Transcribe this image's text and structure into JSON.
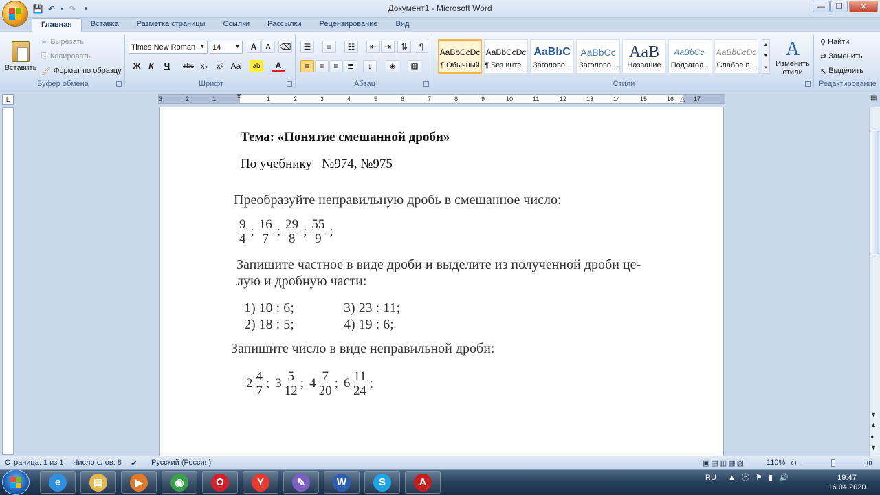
{
  "window": {
    "title": "Документ1 - Microsoft Word",
    "minimize": "—",
    "restore": "❐",
    "close": "✕"
  },
  "qat": {
    "save": "💾",
    "undo": "↶",
    "redo": "↷",
    "more": "▾"
  },
  "tabs": [
    "Главная",
    "Вставка",
    "Разметка страницы",
    "Ссылки",
    "Рассылки",
    "Рецензирование",
    "Вид"
  ],
  "ribbon": {
    "clipboard": {
      "label": "Буфер обмена",
      "paste": "Вставить",
      "cut": "Вырезать",
      "copy": "Копировать",
      "format_painter": "Формат по образцу"
    },
    "font": {
      "label": "Шрифт",
      "font_name": "Times New Roman",
      "font_size": "14",
      "grow": "A",
      "shrink": "A",
      "bold": "Ж",
      "italic": "К",
      "underline": "Ч",
      "strike": "abc",
      "subscript": "x₂",
      "superscript": "x²",
      "case": "Aa",
      "highlight": "ab",
      "font_color": "A"
    },
    "paragraph": {
      "label": "Абзац"
    },
    "styles": {
      "label": "Стили",
      "items": [
        {
          "preview": "AaBbCcDc",
          "name": "¶ Обычный"
        },
        {
          "preview": "AaBbCcDc",
          "name": "¶ Без инте..."
        },
        {
          "preview": "AaBbC",
          "name": "Заголово..."
        },
        {
          "preview": "AaBbCc",
          "name": "Заголово..."
        },
        {
          "preview": "AaB",
          "name": "Название"
        },
        {
          "preview": "AaBbCc.",
          "name": "Подзагол..."
        },
        {
          "preview": "AaBbCcDc",
          "name": "Слабое в..."
        }
      ],
      "change_styles": "Изменить стили"
    },
    "editing": {
      "label": "Редактирование",
      "find": "Найти",
      "replace": "Заменить",
      "select": "Выделить"
    }
  },
  "ruler": {
    "numbers": [
      "3",
      "2",
      "1",
      "1",
      "2",
      "3",
      "4",
      "5",
      "6",
      "7",
      "8",
      "9",
      "10",
      "11",
      "12",
      "13",
      "14",
      "15",
      "16",
      "17"
    ]
  },
  "document": {
    "topic": "Тема: «Понятие смешанной дроби»",
    "textbook": "По учебнику   №974, №975",
    "task1": "Преобразуйте неправильную дробь в смешанное число:",
    "task1_fracs": [
      {
        "n": "9",
        "d": "4"
      },
      {
        "n": "16",
        "d": "7"
      },
      {
        "n": "29",
        "d": "8"
      },
      {
        "n": "55",
        "d": "9"
      }
    ],
    "separator": ";",
    "task2_line1": "Запишите частное в виде дроби и выделите из полученной дроби це-",
    "task2_line2": "лую и дробную части:",
    "task2_items": [
      "1) 10 : 6;",
      "3) 23 : 11;",
      "2) 18 : 5;",
      "4) 19 : 6;"
    ],
    "task3": "Запишите число в виде неправильной дроби:",
    "task3_mixed": [
      {
        "w": "2",
        "n": "4",
        "d": "7"
      },
      {
        "w": "3",
        "n": "5",
        "d": "12"
      },
      {
        "w": "4",
        "n": "7",
        "d": "20"
      },
      {
        "w": "6",
        "n": "11",
        "d": "24"
      }
    ]
  },
  "status": {
    "page": "Страница: 1 из 1",
    "words": "Число слов: 8",
    "language": "Русский (Россия)",
    "zoom": "110%"
  },
  "taskbar": {
    "lang": "RU",
    "time": "19:47",
    "date": "16.04.2020",
    "apps": [
      {
        "name": "ie",
        "glyph": "e",
        "color": "#2d8fe0"
      },
      {
        "name": "explorer",
        "glyph": "▤",
        "color": "#e5b64a"
      },
      {
        "name": "media",
        "glyph": "▶",
        "color": "#e07a28"
      },
      {
        "name": "chrome",
        "glyph": "◉",
        "color": "#3aa04a"
      },
      {
        "name": "opera",
        "glyph": "O",
        "color": "#d4202b"
      },
      {
        "name": "yandex",
        "glyph": "Y",
        "color": "#e63a2e"
      },
      {
        "name": "notes",
        "glyph": "✎",
        "color": "#7d5fc2"
      },
      {
        "name": "word",
        "glyph": "W",
        "color": "#2b5eb3"
      },
      {
        "name": "skype",
        "glyph": "S",
        "color": "#1ca4e4"
      },
      {
        "name": "pdf",
        "glyph": "A",
        "color": "#c51c1c"
      }
    ]
  }
}
